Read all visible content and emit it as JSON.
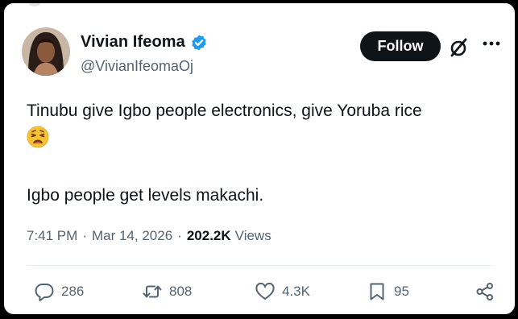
{
  "author": {
    "name": "Vivian Ifeoma",
    "handle": "@VivianIfeomaOj"
  },
  "follow_label": "Follow",
  "tweet": {
    "line1": "Tinubu give Igbo people electronics, give Yoruba rice",
    "emoji_name": "weary-face-emoji",
    "line3": "Igbo people get levels makachi."
  },
  "meta": {
    "time": "7:41 PM",
    "separator": "·",
    "date": "Mar 14, 2026",
    "views_count": "202.2K",
    "views_label": "Views"
  },
  "actions": {
    "replies": "286",
    "reposts": "808",
    "likes": "4.3K",
    "bookmarks": "95"
  },
  "colors": {
    "text": "#0f1419",
    "secondary": "#536471",
    "verified": "#1d9bf0",
    "follow_bg": "#0f1419"
  }
}
